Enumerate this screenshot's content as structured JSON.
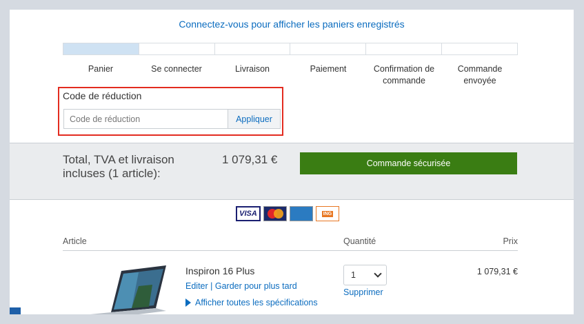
{
  "header": {
    "signin_link": "Connectez-vous pour afficher les paniers enregistrés"
  },
  "steps": [
    {
      "label": "Panier",
      "active": true
    },
    {
      "label": "Se connecter",
      "active": false
    },
    {
      "label": "Livraison",
      "active": false
    },
    {
      "label": "Paiement",
      "active": false
    },
    {
      "label": "Confirmation de commande",
      "active": false
    },
    {
      "label": "Commande envoyée",
      "active": false
    }
  ],
  "promo": {
    "title": "Code de réduction",
    "placeholder": "Code de réduction",
    "apply_label": "Appliquer",
    "highlight_color": "#e32b1f"
  },
  "summary": {
    "total_label": "Total, TVA et livraison incluses (1 article):",
    "total_amount": "1 079,31 €",
    "checkout_label": "Commande sécurisée",
    "checkout_color": "#3a7d13"
  },
  "payment_icons": [
    "visa-icon",
    "mastercard-icon",
    "amex-icon",
    "ing-icon"
  ],
  "payment_text": {
    "visa": "VISA"
  },
  "table": {
    "col_article": "Article",
    "col_quantity": "Quantité",
    "col_price": "Prix"
  },
  "item": {
    "name": "Inspiron 16 Plus",
    "edit_label": "Editer",
    "separator": "|",
    "save_later_label": "Garder pour plus tard",
    "specs_label": "Afficher toutes les spécifications",
    "quantity": "1",
    "remove_label": "Supprimer",
    "price": "1 079,31 €"
  },
  "colors": {
    "link": "#0b6cbf",
    "active_step": "#cfe2f3"
  }
}
